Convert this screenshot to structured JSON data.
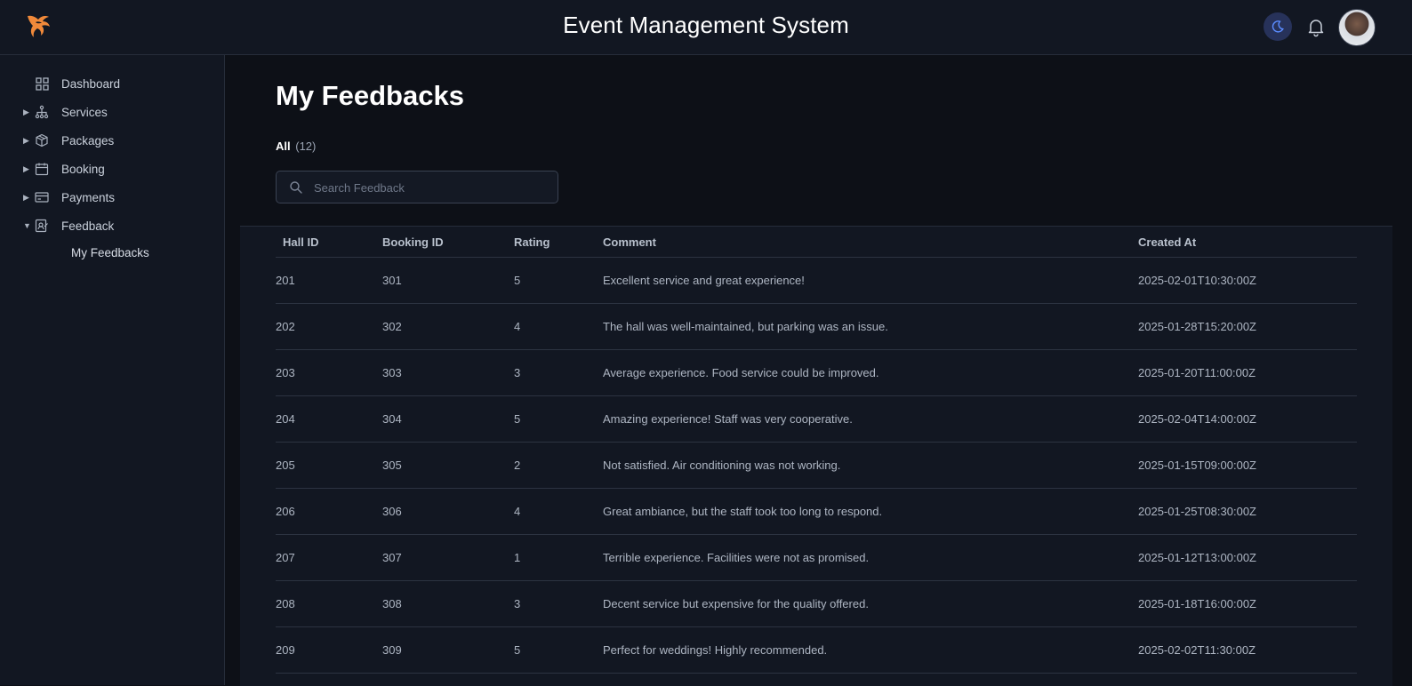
{
  "header": {
    "title": "Event Management System",
    "logo_icon": "phoenix-logo-icon",
    "accent_color": "#f0893a"
  },
  "sidebar": {
    "items": [
      {
        "label": "Dashboard",
        "icon": "grid-icon",
        "expandable": false
      },
      {
        "label": "Services",
        "icon": "sitemap-icon",
        "expandable": true
      },
      {
        "label": "Packages",
        "icon": "box-icon",
        "expandable": true
      },
      {
        "label": "Booking",
        "icon": "calendar-icon",
        "expandable": true
      },
      {
        "label": "Payments",
        "icon": "credit-card-icon",
        "expandable": true
      },
      {
        "label": "Feedback",
        "icon": "feedback-icon",
        "expandable": true,
        "expanded": true
      }
    ],
    "sub_items": [
      {
        "label": "My Feedbacks"
      }
    ]
  },
  "main": {
    "title": "My Feedbacks",
    "filter": {
      "label": "All",
      "count": "(12)"
    },
    "search": {
      "placeholder": "Search Feedback",
      "value": ""
    },
    "table": {
      "columns": [
        "Hall ID",
        "Booking ID",
        "Rating",
        "Comment",
        "Created At"
      ],
      "rows": [
        [
          "201",
          "301",
          "5",
          "Excellent service and great experience!",
          "2025-02-01T10:30:00Z"
        ],
        [
          "202",
          "302",
          "4",
          "The hall was well-maintained, but parking was an issue.",
          "2025-01-28T15:20:00Z"
        ],
        [
          "203",
          "303",
          "3",
          "Average experience. Food service could be improved.",
          "2025-01-20T11:00:00Z"
        ],
        [
          "204",
          "304",
          "5",
          "Amazing experience! Staff was very cooperative.",
          "2025-02-04T14:00:00Z"
        ],
        [
          "205",
          "305",
          "2",
          "Not satisfied. Air conditioning was not working.",
          "2025-01-15T09:00:00Z"
        ],
        [
          "206",
          "306",
          "4",
          "Great ambiance, but the staff took too long to respond.",
          "2025-01-25T08:30:00Z"
        ],
        [
          "207",
          "307",
          "1",
          "Terrible experience. Facilities were not as promised.",
          "2025-01-12T13:00:00Z"
        ],
        [
          "208",
          "308",
          "3",
          "Decent service but expensive for the quality offered.",
          "2025-01-18T16:00:00Z"
        ],
        [
          "209",
          "309",
          "5",
          "Perfect for weddings! Highly recommended.",
          "2025-02-02T11:30:00Z"
        ]
      ]
    }
  }
}
